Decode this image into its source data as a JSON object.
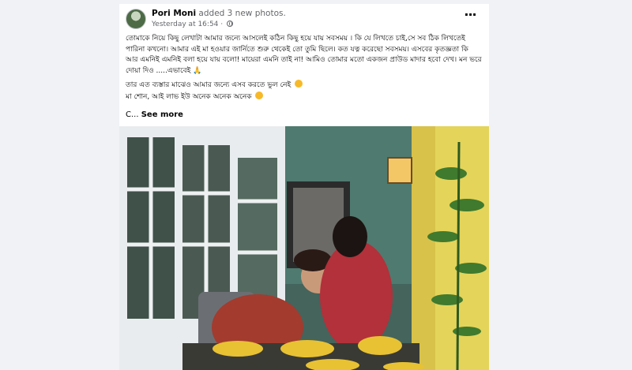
{
  "post": {
    "author": "Pori Moni",
    "action": " added 3 new photos.",
    "timestamp": "Yesterday at 16:54",
    "separator": " · ",
    "privacy_icon": "globe-icon",
    "more_icon": "more-options-icon",
    "text_lines": [
      "তোমাকে নিয়ে কিছু লেখাটা আমার জন্যে আসলেই কঠিন কিছু হয়ে যায় সবসময় । কি যে লিখতে চাই,সে সব ঠিক লিখতেই পারিনা কখনো। আমার এই মা হওয়ার জার্নিতে শুরু থেকেই তো তুমি ছিলে। কত যত্ন করেছো সবসময়। এসবের কৃতজ্ঞতা কি আর এমনিই এমনিই বলা হয়ে যায় বলো! মায়েরা এমনি তাই না! আমিও তোমার মতো একজন প্রাউড মাদার হবো দেখ। মন ভরে দোয়া দিও .....এভাবেই",
      "তার এত ব্যস্তার মাঝেও আমার জন্যে এসব করতে ভুল নেই",
      "মা শোন, আই লাভ ইউ অনেক অনেক অনেক"
    ],
    "see_more_prefix": "C... ",
    "see_more_label": "See more"
  },
  "colors": {
    "background": "#f0f2f5",
    "card": "#ffffff",
    "text": "#050505",
    "secondary_text": "#65676b"
  }
}
